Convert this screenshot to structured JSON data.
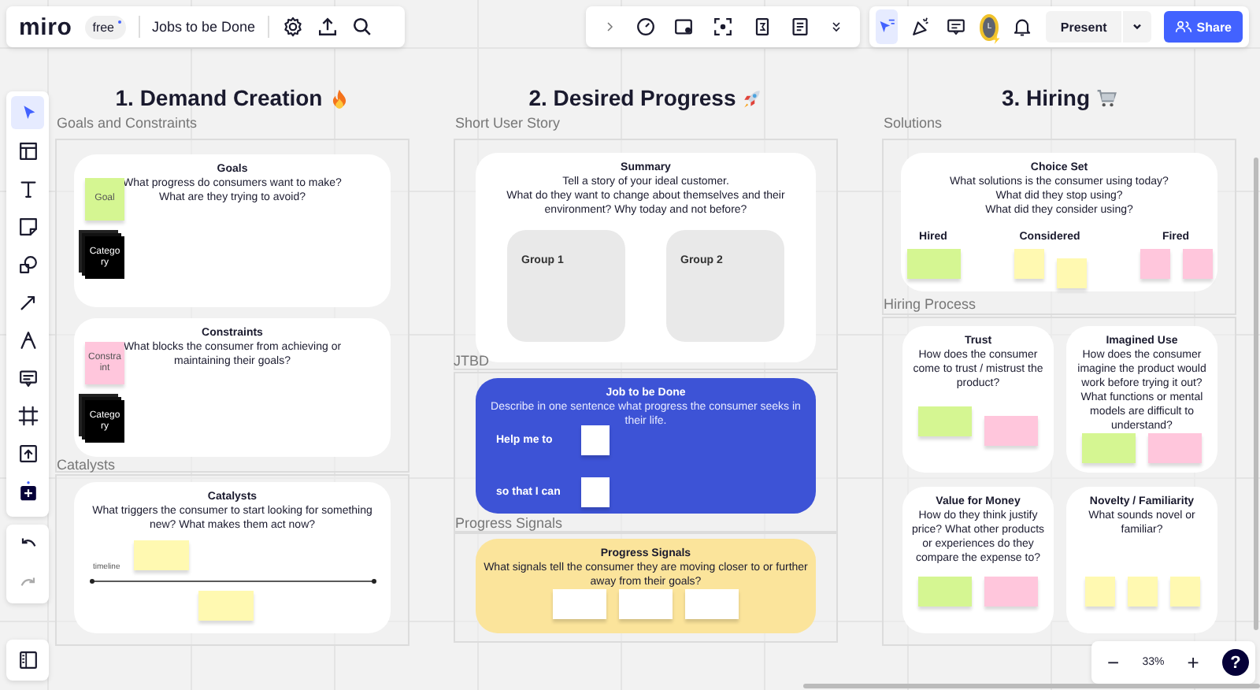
{
  "top_bar": {
    "logo": "miro",
    "plan": "free",
    "board_title": "Jobs to be Done"
  },
  "top_right": {
    "cursor_tool": {
      "selected": true
    },
    "avatar": "L",
    "present": "Present",
    "share": "Share"
  },
  "left_tools": [
    {
      "selected": true
    },
    {
      "selected": false
    },
    {
      "selected": false
    },
    {
      "selected": false
    },
    {
      "selected": false
    },
    {
      "selected": false
    },
    {
      "selected": false
    },
    {
      "selected": false
    },
    {
      "selected": false
    },
    {
      "selected": false
    },
    {
      "selected": false
    }
  ],
  "zoom_controls": {
    "minus": "−",
    "percent": "33%",
    "plus": "+",
    "help": "?"
  },
  "board": {
    "sections": [
      {
        "title": "1. Demand Creation"
      },
      {
        "title": "2. Desired Progress"
      },
      {
        "title": "3. Hiring"
      }
    ],
    "frames": [
      {
        "label": "Goals and Constraints"
      },
      {
        "label": "Catalysts"
      },
      {
        "label": "Short User Story"
      },
      {
        "label": "JTBD"
      },
      {
        "label": "Progress Signals"
      },
      {
        "label": "Solutions"
      },
      {
        "label": "Hiring Process"
      }
    ],
    "cards": [
      {
        "kind": "side",
        "color": "#ffffff",
        "title": "Goals",
        "text": [
          "What progress do consumers want to make?",
          "What are they trying to avoid?"
        ],
        "stickies": [
          {
            "color": "#d5f692",
            "label": "Goal"
          },
          {
            "color": "#000000",
            "label": "Category"
          }
        ]
      },
      {
        "kind": "side",
        "color": "#ffffff",
        "title": "Constraints",
        "text": [
          "What blocks the consumer from achieving or maintaining their goals?"
        ],
        "stickies": [
          {
            "color": "#ffc6dc",
            "label": "Constraint"
          },
          {
            "color": "#000000",
            "label": "Category"
          }
        ]
      },
      {
        "kind": "timeline",
        "color": "#ffffff",
        "title": "Catalysts",
        "text": [
          "What triggers the consumer to start looking for something new? What makes them act now?"
        ],
        "timeline_label": "timeline",
        "stickies": [
          {
            "color": "#fff9b1"
          },
          {
            "color": "#fff9b1"
          }
        ]
      },
      {
        "kind": "groups",
        "color": "#ffffff",
        "title": "Summary",
        "text": [
          "Tell a story of your ideal customer.",
          "What do they want to change about themselves and their environment? Why today and not before?"
        ],
        "groups": [
          {
            "label": "Group 1"
          },
          {
            "label": "Group 2"
          }
        ]
      },
      {
        "kind": "prompts",
        "color": "#3d53d6",
        "title": "Job to be Done",
        "text": [
          "Describe in one sentence what progress the consumer seeks in their life."
        ],
        "prompts": [
          {
            "label": "Help me to"
          },
          {
            "label": "so that I can"
          }
        ]
      },
      {
        "kind": "row",
        "color": "#fbe49b",
        "title": "Progress Signals",
        "text": [
          "What signals tell the consumer they are moving closer to or further away from their goals?"
        ],
        "stickies": [
          {
            "color": "#ffffff"
          },
          {
            "color": "#ffffff"
          },
          {
            "color": "#ffffff"
          }
        ]
      },
      {
        "kind": "sorted",
        "color": "#ffffff",
        "title": "Choice Set",
        "text": [
          "What solutions is the consumer using today?",
          "What did they stop using?",
          "What did they consider using?"
        ],
        "groups": [
          {
            "label": "Hired",
            "stickies": [
              {
                "color": "#d5f692"
              }
            ]
          },
          {
            "label": "Considered",
            "stickies": [
              {
                "color": "#fff9b1"
              },
              {
                "color": "#fff9b1"
              }
            ]
          },
          {
            "label": "Fired",
            "stickies": [
              {
                "color": "#ffc6dc"
              },
              {
                "color": "#ffc6dc"
              }
            ]
          }
        ]
      },
      {
        "kind": "row",
        "color": "#ffffff",
        "title": "Trust",
        "text": [
          "How does the consumer come to trust / mistrust the product?"
        ],
        "stickies": [
          {
            "color": "#d5f692"
          },
          {
            "color": "#ffc6dc"
          }
        ]
      },
      {
        "kind": "row",
        "color": "#ffffff",
        "title": "Imagined Use",
        "text": [
          "How does the consumer imagine the product would work before trying it out? What functions or mental models are difficult to understand?"
        ],
        "stickies": [
          {
            "color": "#d5f692"
          },
          {
            "color": "#ffc6dc"
          }
        ]
      },
      {
        "kind": "row",
        "color": "#ffffff",
        "title": "Value for Money",
        "text": [
          "How do they think justify price? What other products or experiences do they compare the expense to?"
        ],
        "stickies": [
          {
            "color": "#d5f692"
          },
          {
            "color": "#ffc6dc"
          }
        ]
      },
      {
        "kind": "row",
        "color": "#ffffff",
        "title": "Novelty / Familiarity",
        "text": [
          "What sounds novel or familiar?"
        ],
        "stickies": [
          {
            "color": "#fff9b1"
          },
          {
            "color": "#fff9b1"
          },
          {
            "color": "#fff9b1"
          }
        ]
      }
    ]
  }
}
